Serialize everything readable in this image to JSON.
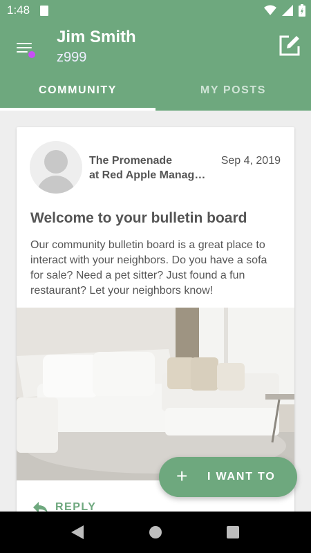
{
  "status": {
    "time": "1:48"
  },
  "header": {
    "name": "Jim Smith",
    "subtitle": "z999"
  },
  "tabs": [
    {
      "label": "COMMUNITY"
    },
    {
      "label": "MY POSTS"
    }
  ],
  "post": {
    "org_line1": "The Promenade",
    "org_line2": "at Red Apple Management",
    "date": "Sep 4, 2019",
    "title": "Welcome to your bulletin board",
    "body": "Our community bulletin board is a great place to interact with your neighbors.  Do you have a sofa for sale?  Need a pet sitter?  Just found a fun restaurant?  Let your neighbors know!",
    "reply_label": "REPLY"
  },
  "fab": {
    "label": "I WANT TO"
  },
  "icons": {
    "menu": "menu-icon",
    "edit": "edit-icon",
    "reply": "reply-icon",
    "plus": "plus-icon"
  },
  "colors": {
    "accent": "#6ea87e",
    "notification_dot": "#c750f5"
  }
}
